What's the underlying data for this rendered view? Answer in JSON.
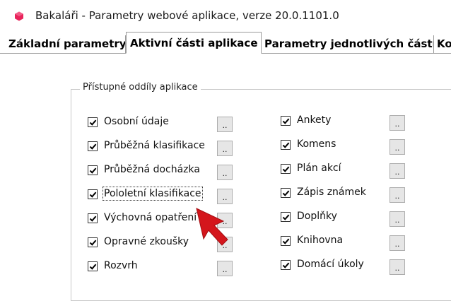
{
  "window": {
    "title": "Bakaláři - Parametry webové aplikace, verze 20.0.1101.0",
    "icon": "bakalari-app-icon",
    "icon_color": "#e8245b"
  },
  "tabs": [
    {
      "label": "Základní parametry",
      "active": false
    },
    {
      "label": "Aktivní části aplikace",
      "active": true
    },
    {
      "label": "Parametry jednotlivých částí",
      "active": false
    },
    {
      "label": "Ko",
      "active": false
    }
  ],
  "group": {
    "legend": "Přístupné oddíly aplikace"
  },
  "left_items": [
    {
      "label": "Osobní údaje",
      "checked": true,
      "button": ".."
    },
    {
      "label": "Průběžná klasifikace",
      "checked": true,
      "button": ".."
    },
    {
      "label": "Průběžná docházka",
      "checked": true,
      "button": ".."
    },
    {
      "label": "Pololetní klasifikace",
      "checked": true,
      "button": "..",
      "focused": true
    },
    {
      "label": "Výchovná opatření",
      "checked": true,
      "button": ".."
    },
    {
      "label": "Opravné zkoušky",
      "checked": true,
      "button": ".."
    },
    {
      "label": "Rozvrh",
      "checked": true,
      "button": ".."
    }
  ],
  "right_items": [
    {
      "label": "Ankety",
      "checked": true,
      "button": ".."
    },
    {
      "label": "Komens",
      "checked": true,
      "button": ".."
    },
    {
      "label": "Plán akcí",
      "checked": true,
      "button": ".."
    },
    {
      "label": "Zápis známek",
      "checked": true,
      "button": ".."
    },
    {
      "label": "Doplňky",
      "checked": true,
      "button": ".."
    },
    {
      "label": "Knihovna",
      "checked": true,
      "button": ".."
    },
    {
      "label": "Domácí úkoly",
      "checked": true,
      "button": ".."
    }
  ],
  "annotation": {
    "icon": "red-arrow-pointer-icon",
    "color": "#d4161c"
  }
}
